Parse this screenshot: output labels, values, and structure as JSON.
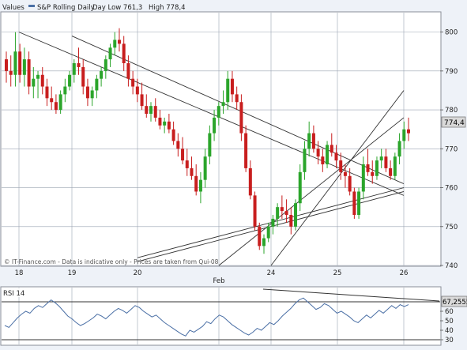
{
  "header": {
    "values_label": "Values",
    "series_name": "S&P Rolling Daily",
    "day_low_label": "Day Low 761,3",
    "high_label": "High 778,4"
  },
  "watermark": "© IT-Finance.com - Data is indicative only - Prices are taken from Qui-08",
  "colors": {
    "up": "#2ba52b",
    "down": "#c81e1e",
    "rsi_line": "#4a6fa5",
    "trendline": "#333333",
    "last_price_box": "#d9d9d9"
  },
  "chart_data": [
    {
      "type": "candlestick",
      "title": "S&P Rolling Daily",
      "ylim": [
        740,
        805
      ],
      "y_ticks": [
        740,
        750,
        760,
        770,
        780,
        790,
        800
      ],
      "x_ticks": [
        "18",
        "19",
        "20",
        "Feb",
        "24",
        "25",
        "26"
      ],
      "last_price_label": "774,4",
      "grid": true,
      "candles": [
        [
          793,
          795,
          787,
          790
        ],
        [
          790,
          794,
          786,
          789
        ],
        [
          789,
          800,
          786,
          795
        ],
        [
          795,
          797,
          787,
          789
        ],
        [
          789,
          796,
          786,
          793
        ],
        [
          793,
          795,
          784,
          786
        ],
        [
          786,
          791,
          783,
          788
        ],
        [
          788,
          790,
          783,
          789
        ],
        [
          789,
          791,
          784,
          786
        ],
        [
          786,
          788,
          781,
          783
        ],
        [
          783,
          786,
          780,
          782
        ],
        [
          782,
          784,
          779,
          780
        ],
        [
          780,
          785,
          779,
          784
        ],
        [
          784,
          788,
          782,
          786
        ],
        [
          786,
          790,
          785,
          789
        ],
        [
          789,
          793,
          787,
          792
        ],
        [
          792,
          796,
          789,
          791
        ],
        [
          791,
          793,
          784,
          786
        ],
        [
          786,
          788,
          781,
          783
        ],
        [
          783,
          786,
          781,
          785
        ],
        [
          785,
          789,
          783,
          788
        ],
        [
          788,
          791,
          786,
          790
        ],
        [
          790,
          794,
          788,
          793
        ],
        [
          793,
          797,
          791,
          796
        ],
        [
          796,
          800,
          794,
          798
        ],
        [
          798,
          801,
          795,
          797
        ],
        [
          797,
          799,
          790,
          792
        ],
        [
          792,
          794,
          786,
          788
        ],
        [
          788,
          790,
          784,
          786
        ],
        [
          786,
          788,
          782,
          784
        ],
        [
          784,
          787,
          780,
          781
        ],
        [
          781,
          784,
          778,
          779
        ],
        [
          779,
          782,
          777,
          781
        ],
        [
          781,
          783,
          777,
          778
        ],
        [
          778,
          780,
          775,
          776
        ],
        [
          776,
          778,
          774,
          777
        ],
        [
          777,
          779,
          774,
          775
        ],
        [
          775,
          777,
          771,
          772
        ],
        [
          772,
          774,
          768,
          770
        ],
        [
          770,
          773,
          766,
          767
        ],
        [
          767,
          770,
          763,
          765
        ],
        [
          765,
          768,
          762,
          763
        ],
        [
          763,
          766,
          758,
          759
        ],
        [
          759,
          764,
          756,
          762
        ],
        [
          762,
          770,
          760,
          768
        ],
        [
          768,
          776,
          766,
          774
        ],
        [
          774,
          780,
          772,
          778
        ],
        [
          778,
          782,
          776,
          781
        ],
        [
          781,
          785,
          779,
          782
        ],
        [
          782,
          790,
          780,
          788
        ],
        [
          788,
          790,
          782,
          784
        ],
        [
          784,
          786,
          780,
          782
        ],
        [
          782,
          784,
          772,
          774
        ],
        [
          774,
          776,
          764,
          765
        ],
        [
          765,
          767,
          757,
          758
        ],
        [
          758,
          759,
          749,
          750
        ],
        [
          750,
          751,
          744,
          745
        ],
        [
          745,
          748,
          743,
          747
        ],
        [
          747,
          751,
          746,
          750
        ],
        [
          750,
          753,
          748,
          752
        ],
        [
          752,
          756,
          750,
          755
        ],
        [
          755,
          758,
          752,
          754
        ],
        [
          754,
          757,
          751,
          753
        ],
        [
          753,
          755,
          748,
          750
        ],
        [
          750,
          757,
          749,
          756
        ],
        [
          756,
          766,
          754,
          764
        ],
        [
          764,
          772,
          762,
          770
        ],
        [
          770,
          777,
          768,
          774
        ],
        [
          774,
          776,
          769,
          770
        ],
        [
          770,
          772,
          766,
          768
        ],
        [
          768,
          770,
          764,
          766
        ],
        [
          766,
          772,
          765,
          771
        ],
        [
          771,
          774,
          768,
          769
        ],
        [
          769,
          771,
          765,
          767
        ],
        [
          767,
          769,
          762,
          764
        ],
        [
          764,
          766,
          760,
          763
        ],
        [
          763,
          765,
          758,
          759
        ],
        [
          759,
          760,
          752,
          753
        ],
        [
          753,
          760,
          752,
          759
        ],
        [
          759,
          768,
          757,
          766
        ],
        [
          766,
          770,
          763,
          764
        ],
        [
          764,
          767,
          761,
          763
        ],
        [
          763,
          768,
          762,
          767
        ],
        [
          767,
          770,
          765,
          768
        ],
        [
          768,
          770,
          764,
          765
        ],
        [
          765,
          767,
          762,
          763
        ],
        [
          763,
          769,
          762,
          768
        ],
        [
          768,
          774,
          766,
          772
        ],
        [
          772,
          777,
          770,
          775
        ],
        [
          775,
          778,
          772,
          774
        ]
      ],
      "trendlines": [
        {
          "from": [
            "18",
            800
          ],
          "to": [
            "26",
            758
          ]
        },
        {
          "from": [
            "19",
            799
          ],
          "to": [
            "26",
            761
          ]
        },
        {
          "from": [
            "20",
            742
          ],
          "to": [
            "26",
            760
          ]
        },
        {
          "from": [
            "20",
            741
          ],
          "to": [
            "26",
            759
          ]
        },
        {
          "from": [
            "Feb",
            740
          ],
          "to": [
            "26",
            778
          ]
        },
        {
          "from": [
            "24",
            740
          ],
          "to": [
            "26",
            785
          ]
        }
      ]
    },
    {
      "type": "line",
      "title": "RSI 14",
      "ylim": [
        25,
        85
      ],
      "y_ticks": [
        30,
        40,
        50,
        60
      ],
      "last_value_label": "67,2555",
      "reference_lines": [
        30,
        70
      ],
      "values": [
        45,
        43,
        48,
        53,
        57,
        60,
        58,
        63,
        66,
        64,
        68,
        72,
        69,
        65,
        60,
        55,
        52,
        48,
        45,
        47,
        50,
        53,
        57,
        55,
        52,
        56,
        60,
        63,
        61,
        58,
        62,
        66,
        64,
        60,
        57,
        54,
        56,
        52,
        48,
        45,
        42,
        39,
        36,
        34,
        40,
        38,
        41,
        44,
        49,
        47,
        52,
        56,
        54,
        50,
        46,
        43,
        40,
        37,
        35,
        38,
        42,
        40,
        44,
        48,
        46,
        50,
        55,
        59,
        63,
        68,
        72,
        74,
        70,
        66,
        62,
        64,
        68,
        66,
        62,
        58,
        60,
        57,
        54,
        50,
        48,
        52,
        56,
        53,
        57,
        61,
        58,
        62,
        66,
        63,
        67,
        65,
        67
      ]
    }
  ]
}
